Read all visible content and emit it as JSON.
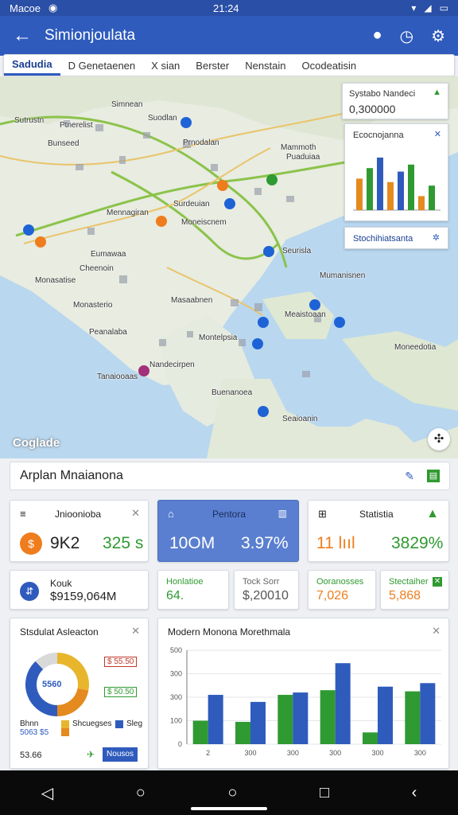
{
  "status_bar": {
    "left_text": "Macoe",
    "time": "21:24"
  },
  "app_bar": {
    "title": "Simionjoulata"
  },
  "tabs": [
    {
      "label": "Sadudia"
    },
    {
      "label": "D Genetaenen"
    },
    {
      "label": "X sian"
    },
    {
      "label": "Berster"
    },
    {
      "label": "Nenstain"
    },
    {
      "label": "Ocodeatisin"
    }
  ],
  "map": {
    "labels": [
      "Sutrustn",
      "Ptnerelist",
      "Simnean",
      "Suodlan",
      "Prnodalan",
      "Mammoth",
      "Puaduiaa",
      "Bunseed",
      "Mennagiran",
      "Surdeuian",
      "Moneiscnem",
      "Eumawaa",
      "Cheenoin",
      "Monasatise",
      "Monasterio",
      "Seurisla",
      "Mumanisnen",
      "Meaistoaan",
      "Masaabnen",
      "Montelpsia",
      "Nandecirpen",
      "Tanaiooaas",
      "Seaioanin",
      "Moneedotia",
      "Buenanoea",
      "Peanalaba"
    ],
    "watermark": "Coglade"
  },
  "overlay_stats": {
    "title": "Systabo Nandeci",
    "value": "0,300000"
  },
  "overlay_chart": {
    "title": "Ecocnojanna"
  },
  "overlay_link": {
    "label": "Stochihiatsanta"
  },
  "search": {
    "text": "Arplan Mnaianona"
  },
  "cards": {
    "c1": {
      "title": "Jnioonioba",
      "value_a": "9K2",
      "value_b": "325 s"
    },
    "c2": {
      "title": "Pentora",
      "value_a": "10OM",
      "value_b": "3.97%"
    },
    "c3": {
      "title": "Statistia",
      "value_a": "11 lııl",
      "value_b": "3829%"
    },
    "c4": {
      "title": "Kouk",
      "value": "$9159,064M"
    },
    "c5": {
      "title": "Honlatioe",
      "value": "64."
    },
    "c6": {
      "title": "Tock Sorr",
      "value": "$,20010"
    },
    "c7": {
      "title": "Ooranosses",
      "value": "7,026"
    },
    "c8": {
      "title": "Stectaiher",
      "value": "5,868"
    }
  },
  "donut_card": {
    "title": "Stsdulat Asleacton",
    "center": "5560",
    "tag1": "$ 55.50",
    "tag2": "$ 50.50",
    "legend": [
      "Bhnn",
      "Shcuegses",
      "Sleg"
    ],
    "legend_value": "5063 $5",
    "footer": "53.66",
    "button": "Nousos",
    "colors": [
      "#e7b62d",
      "#e48a1f",
      "#2f5bbd",
      "#d9d9d9"
    ]
  },
  "bar_card": {
    "title": "Modern Monona Morethmala"
  },
  "chart_data": {
    "type": "bar",
    "categories": [
      "2",
      "300",
      "300",
      "300",
      "300",
      "300"
    ],
    "y_tick_labels": [
      "0",
      "100",
      "300",
      "300",
      "500"
    ],
    "series": [
      {
        "values": [
          100,
          95,
          210,
          230,
          50,
          225
        ],
        "color": "#2f9a31"
      },
      {
        "values": [
          210,
          180,
          220,
          345,
          245,
          260
        ],
        "color": "#2f5bbd"
      }
    ],
    "ylim": [
      0,
      400
    ]
  },
  "mini_chart": {
    "type": "bar",
    "values": [
      9,
      12,
      15,
      8,
      11,
      13,
      4,
      7
    ],
    "colors": [
      "#e48a1f",
      "#2f9a31",
      "#2f5bbd",
      "#e48a1f",
      "#2f5bbd",
      "#2f9a31",
      "#e48a1f",
      "#2f9a31"
    ]
  }
}
